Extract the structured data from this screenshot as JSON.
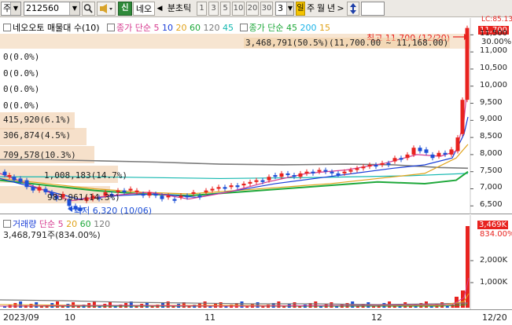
{
  "toolbar": {
    "market_select": "주",
    "code_input": "212560",
    "search_icon": "magnifier",
    "sound_icon": "speaker",
    "new_btn": "신",
    "stock_name": "네오",
    "prev_arrow": "◀",
    "period_label": "분초틱",
    "minute_options": [
      "1",
      "3",
      "5",
      "10",
      "20",
      "30"
    ],
    "interval_value": "3",
    "period_tabs": [
      "일",
      "주",
      "월",
      "년"
    ],
    "next_arrow": ">",
    "updown_icon": "up-down-arrows",
    "extra_input": ""
  },
  "price_legend": {
    "name": "네오오토 매물대 수(10)",
    "ma_label": "종가 단순",
    "ma_periods": [
      "5",
      "10",
      "20",
      "60",
      "120",
      "45"
    ],
    "ma2_label": "종가 단순",
    "ma2_periods": [
      "45",
      "200",
      "15"
    ]
  },
  "price_info": {
    "max_label": "최고 11,700 (12/20)",
    "summary": "3,468,791(50.5%)(11,700.00 ~ 11,168.00)",
    "min_label": "최저 6,320 (10/06)",
    "profile_rows": [
      "0(0.0%)",
      "0(0.0%)",
      "0(0.0%)",
      "0(0.0%)",
      "415,920(6.1%)",
      "306,874(4.5%)",
      "709,578(10.3%)",
      "1,008,183(14.7%)",
      "983,961(14.3%)"
    ]
  },
  "price_axis": {
    "ticks": [
      "11,500",
      "11,000",
      "10,500",
      "10,000",
      "9,500",
      "9,000",
      "8,500",
      "8,000",
      "7,500",
      "7,000",
      "6,500"
    ],
    "top_label": "LC:85.13",
    "current_price": "11,700",
    "upper_label": "30.00%"
  },
  "volume_legend": {
    "name": "거래량",
    "ma_label": "단순",
    "ma_periods": [
      "5",
      "20",
      "60",
      "120"
    ],
    "summary": "3,468,791주(834.00%)"
  },
  "volume_axis": {
    "ticks": [
      "2,000K",
      "1,000K"
    ],
    "current_volume": "3,469K",
    "upper_label": "834.00%"
  },
  "date_axis": {
    "labels": [
      "2023/09",
      "10",
      "11",
      "12",
      "12/20"
    ]
  },
  "colors": {
    "up": "#e8231f",
    "down": "#1d4fd6",
    "ma5": "#d63a8f",
    "ma10": "#1a3ed8",
    "ma20": "#e0a219",
    "ma60": "#1ea83a",
    "ma120": "#7a7a7a",
    "ma45": "#14b8b0",
    "profile": "#f2d3b3"
  }
}
